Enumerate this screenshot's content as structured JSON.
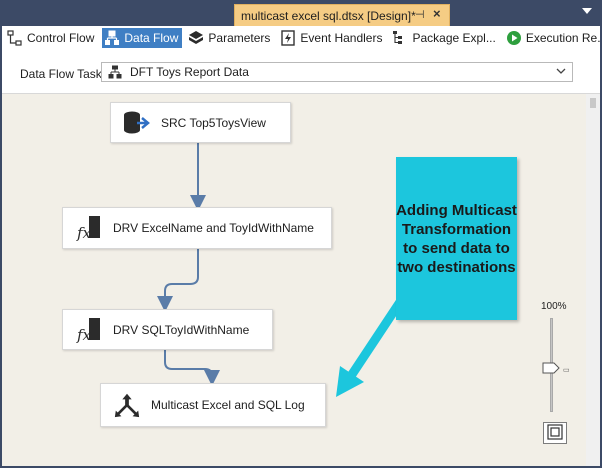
{
  "document_tab": {
    "title": "multicast excel sql.dtsx [Design]*",
    "pin_glyph": "⊣",
    "close_glyph": "×"
  },
  "designer_tabs": [
    {
      "label": "Control Flow",
      "icon": "control-flow-icon",
      "active": false
    },
    {
      "label": "Data Flow",
      "icon": "data-flow-icon",
      "active": true
    },
    {
      "label": "Parameters",
      "icon": "parameters-icon",
      "active": false
    },
    {
      "label": "Event Handlers",
      "icon": "event-handlers-icon",
      "active": false
    },
    {
      "label": "Package Expl...",
      "icon": "package-explorer-icon",
      "active": false
    },
    {
      "label": "Execution Re...",
      "icon": "execution-results-icon",
      "active": false
    }
  ],
  "task_selector": {
    "label": "Data Flow Task:",
    "value": "DFT Toys Report Data"
  },
  "components": [
    {
      "label": "SRC Top5ToysView",
      "icon": "ole-db-source-icon"
    },
    {
      "label": "DRV ExcelName and ToyIdWithName",
      "icon": "derived-column-icon"
    },
    {
      "label": "DRV SQLToyIdWithName",
      "icon": "derived-column-icon"
    },
    {
      "label": "Multicast Excel and SQL Log",
      "icon": "multicast-icon"
    }
  ],
  "callout": {
    "lines": [
      "Adding Multicast",
      "Transformation",
      "to send data to",
      "two destinations"
    ]
  },
  "zoom": {
    "label": "100%",
    "percent": 100
  },
  "colors": {
    "title_bar": "#3c4a66",
    "document_tab": "#f5cc84",
    "active_tab": "#3f7fc4",
    "canvas": "#f2efe7",
    "callout": "#1cc6dd",
    "connector": "#5a7ca8"
  }
}
